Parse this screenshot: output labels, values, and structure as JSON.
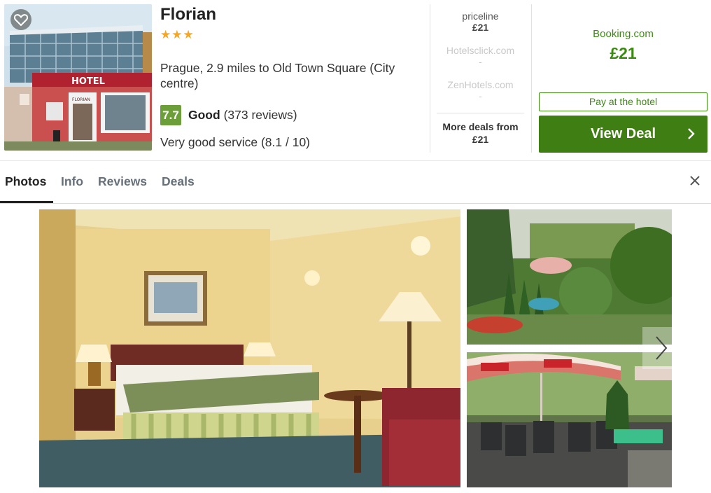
{
  "hotel": {
    "name": "Florian",
    "stars": "★★★",
    "location": "Prague, 2.9 miles to Old Town Square (City centre)",
    "score": "7.7",
    "rating_word": "Good",
    "reviews": "(373 reviews)",
    "service": "Very good service (8.1 / 10)",
    "thumb_sign": "HOTEL",
    "thumb_sign2": "FLORIAN"
  },
  "providers": [
    {
      "name": "priceline",
      "price": "£21",
      "dim": false
    },
    {
      "name": "Hotelsclick.com",
      "price": "-",
      "dim": true
    },
    {
      "name": "ZenHotels.com",
      "price": "-",
      "dim": true
    }
  ],
  "more_deals": {
    "line1": "More deals from",
    "line2": "£21"
  },
  "best_deal": {
    "provider": "Booking.com",
    "price": "£21",
    "pay_label": "Pay at the hotel",
    "cta": "View Deal"
  },
  "tabs": [
    {
      "label": "Photos",
      "active": true
    },
    {
      "label": "Info",
      "active": false
    },
    {
      "label": "Reviews",
      "active": false
    },
    {
      "label": "Deals",
      "active": false
    }
  ],
  "icons": {
    "favorite": "heart-icon",
    "close": "close-icon",
    "chevron": "chevron-right-icon",
    "next": "next-arrow-icon"
  },
  "colors": {
    "accent_green": "#3f7e12",
    "score_green": "#6c9e3a",
    "star": "#f5a623"
  }
}
